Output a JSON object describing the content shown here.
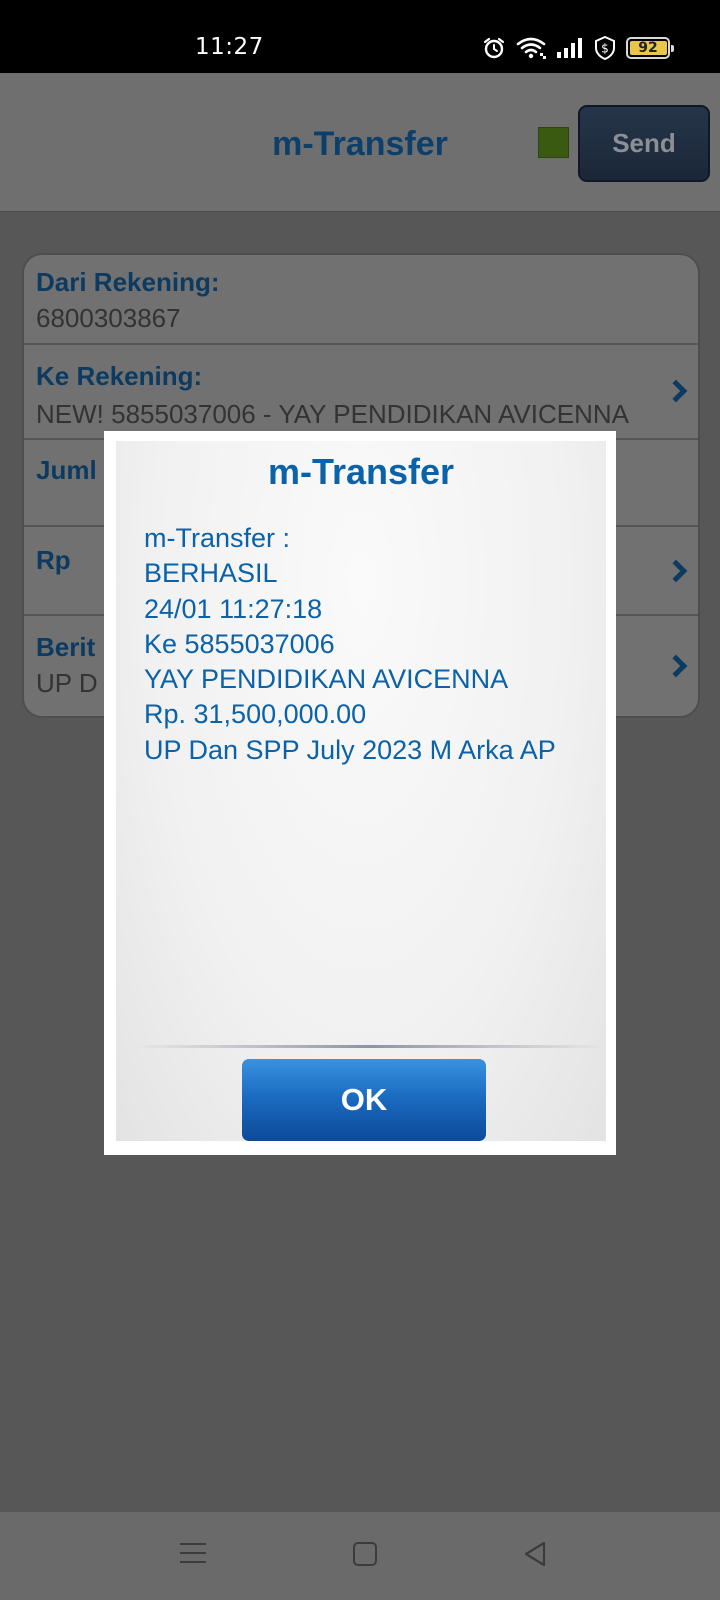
{
  "status_bar": {
    "time": "11:27",
    "battery_level": "92",
    "icons": [
      "alarm-icon",
      "wifi-icon",
      "signal-icon",
      "shield-dollar-icon",
      "battery-icon"
    ]
  },
  "header": {
    "title": "m-Transfer",
    "send_label": "Send",
    "indicator_color": "#5e9a1d"
  },
  "form": {
    "from_label": "Dari Rekening:",
    "from_value": "6800303867",
    "to_label": "Ke Rekening:",
    "to_value": "NEW! 5855037006 - YAY PENDIDIKAN AVICENNA",
    "amount_label": "Juml",
    "currency_label": "Rp",
    "note_label": "Berit",
    "note_value": "UP D"
  },
  "dialog": {
    "title": "m-Transfer",
    "lines": [
      "m-Transfer :",
      "BERHASIL",
      "24/01 11:27:18",
      "Ke 5855037006",
      "YAY PENDIDIKAN AVICENNA",
      "Rp. 31,500,000.00",
      "UP Dan SPP July 2023 M Arka AP"
    ],
    "ok_label": "OK"
  },
  "colors": {
    "accent_blue": "#0b62a8",
    "ok_button": "#1b6cc2",
    "status_bar": "#000000"
  }
}
